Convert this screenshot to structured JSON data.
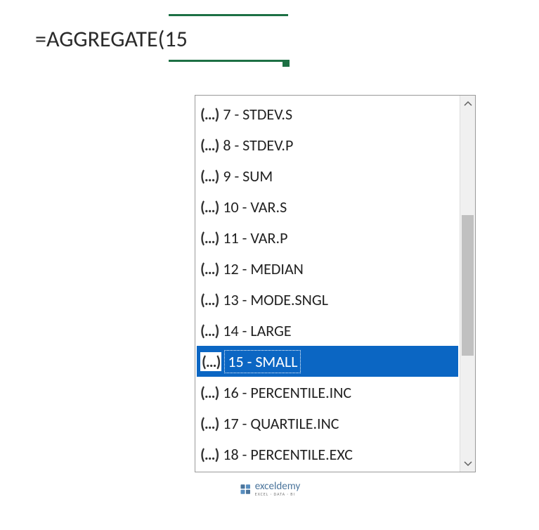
{
  "formula": {
    "prefix": "=AGGREGATE(",
    "arg": "15"
  },
  "dropdown": {
    "items": [
      {
        "id": 7,
        "label": "7 - STDEV.S",
        "selected": false
      },
      {
        "id": 8,
        "label": "8 - STDEV.P",
        "selected": false
      },
      {
        "id": 9,
        "label": "9 - SUM",
        "selected": false
      },
      {
        "id": 10,
        "label": "10 - VAR.S",
        "selected": false
      },
      {
        "id": 11,
        "label": "11 - VAR.P",
        "selected": false
      },
      {
        "id": 12,
        "label": "12 - MEDIAN",
        "selected": false
      },
      {
        "id": 13,
        "label": "13 - MODE.SNGL",
        "selected": false
      },
      {
        "id": 14,
        "label": "14 - LARGE",
        "selected": false
      },
      {
        "id": 15,
        "label": "15 - SMALL",
        "selected": true
      },
      {
        "id": 16,
        "label": "16 - PERCENTILE.INC",
        "selected": false
      },
      {
        "id": 17,
        "label": "17 - QUARTILE.INC",
        "selected": false
      },
      {
        "id": 18,
        "label": "18 - PERCENTILE.EXC",
        "selected": false
      }
    ],
    "paren_icon": "(...)"
  },
  "watermark": {
    "brand": "exceldemy",
    "tagline": "EXCEL · DATA · BI"
  }
}
